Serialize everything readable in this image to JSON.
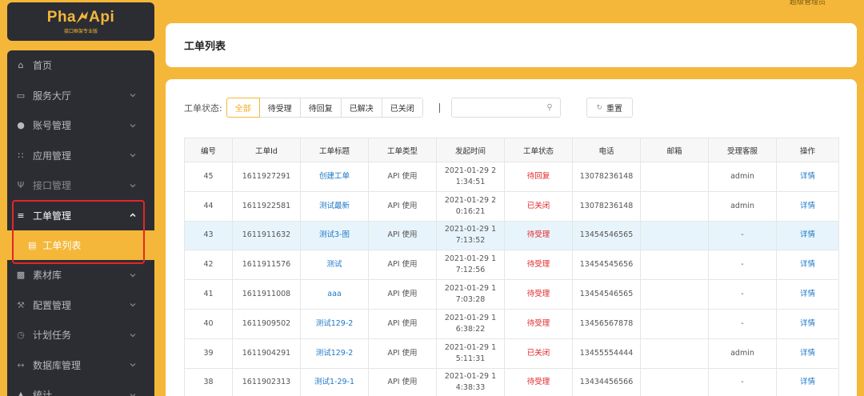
{
  "app": {
    "logo_text": "PhalApi",
    "logo_sub": "接口框架专业版",
    "admin_name": "超级管理员"
  },
  "sidebar": {
    "items": [
      {
        "label": "首页",
        "icon": "home-icon"
      },
      {
        "label": "服务大厅",
        "icon": "monitor-icon"
      },
      {
        "label": "账号管理",
        "icon": "user-icon"
      },
      {
        "label": "应用管理",
        "icon": "grid-icon"
      },
      {
        "label": "接口管理",
        "icon": "plug-icon"
      },
      {
        "label": "工单管理",
        "icon": "list-icon",
        "sub": {
          "label": "工单列表",
          "icon": "document-icon"
        }
      },
      {
        "label": "素材库",
        "icon": "image-icon"
      },
      {
        "label": "配置管理",
        "icon": "wrench-icon"
      },
      {
        "label": "计划任务",
        "icon": "clock-icon"
      },
      {
        "label": "数据库管理",
        "icon": "code-icon"
      },
      {
        "label": "统计",
        "icon": "chart-icon"
      }
    ]
  },
  "header": {
    "title": "工单列表"
  },
  "filter": {
    "label": "工单状态:",
    "options": [
      "全部",
      "待受理",
      "待回复",
      "已解决",
      "已关闭"
    ],
    "selected": "全部",
    "search_placeholder": "",
    "reset_label": "重置"
  },
  "table": {
    "columns": [
      "编号",
      "工单Id",
      "工单标题",
      "工单类型",
      "发起时间",
      "工单状态",
      "电话",
      "邮箱",
      "受理客服",
      "操作"
    ],
    "rows": [
      {
        "no": "45",
        "id": "1611927291",
        "title": "创建工单",
        "type": "API 使用",
        "time1": "2021-01-29 2",
        "time2": "1:34:51",
        "status": "待回复",
        "phone": "13078236148",
        "email": "",
        "agent": "admin",
        "action": "详情"
      },
      {
        "no": "44",
        "id": "1611922581",
        "title": "测试最新",
        "type": "API 使用",
        "time1": "2021-01-29 2",
        "time2": "0:16:21",
        "status": "已关闭",
        "phone": "13078236148",
        "email": "",
        "agent": "admin",
        "action": "详情"
      },
      {
        "no": "43",
        "id": "1611911632",
        "title": "测试3-图",
        "type": "API 使用",
        "time1": "2021-01-29 1",
        "time2": "7:13:52",
        "status": "待受理",
        "phone": "13454546565",
        "email": "",
        "agent": "-",
        "action": "详情"
      },
      {
        "no": "42",
        "id": "1611911576",
        "title": "测试",
        "type": "API 使用",
        "time1": "2021-01-29 1",
        "time2": "7:12:56",
        "status": "待受理",
        "phone": "13454545656",
        "email": "",
        "agent": "-",
        "action": "详情"
      },
      {
        "no": "41",
        "id": "1611911008",
        "title": "aaa",
        "type": "API 使用",
        "time1": "2021-01-29 1",
        "time2": "7:03:28",
        "status": "待受理",
        "phone": "13454546565",
        "email": "",
        "agent": "-",
        "action": "详情"
      },
      {
        "no": "40",
        "id": "1611909502",
        "title": "测试129-2",
        "type": "API 使用",
        "time1": "2021-01-29 1",
        "time2": "6:38:22",
        "status": "待受理",
        "phone": "13456567878",
        "email": "",
        "agent": "-",
        "action": "详情"
      },
      {
        "no": "39",
        "id": "1611904291",
        "title": "测试129-2",
        "type": "API 使用",
        "time1": "2021-01-29 1",
        "time2": "5:11:31",
        "status": "已关闭",
        "phone": "13455554444",
        "email": "",
        "agent": "admin",
        "action": "详情"
      },
      {
        "no": "38",
        "id": "1611902313",
        "title": "测试1-29-1",
        "type": "API 使用",
        "time1": "2021-01-29 1",
        "time2": "4:38:33",
        "status": "待受理",
        "phone": "13434456566",
        "email": "",
        "agent": "-",
        "action": "详情"
      }
    ]
  },
  "colors": {
    "accent": "#f4b73a",
    "sidebar_bg": "#2c2d33",
    "status_red": "#e3262a",
    "link_blue": "#1e78c8"
  }
}
